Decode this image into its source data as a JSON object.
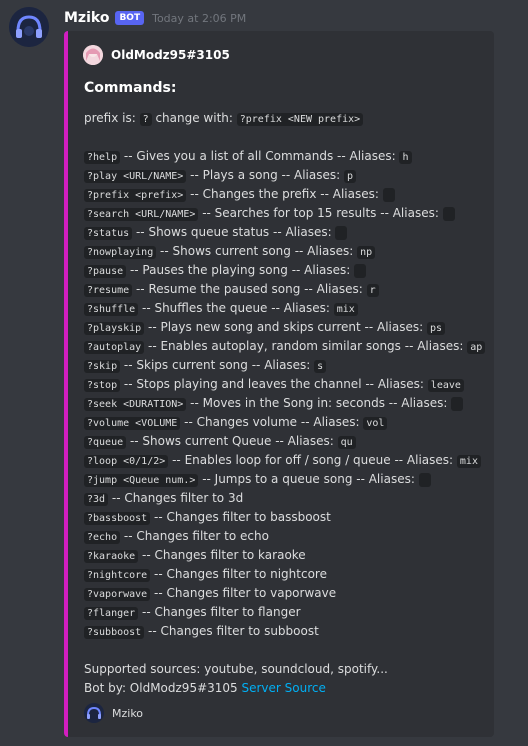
{
  "message": {
    "username": "Mziko",
    "bot_tag": "BOT",
    "timestamp": "Today at 2:06 PM"
  },
  "embed": {
    "accent_color": "#d21ec0",
    "author": "OldModz95#3105",
    "title": "Commands:",
    "prefix_line": {
      "text1": "prefix is: ",
      "code1": "?",
      "text2": " change with: ",
      "code2": "?prefix <NEW prefix>"
    },
    "commands": [
      {
        "cmd": "?help",
        "desc": " -- Gives you a list of all Commands -- Aliases: ",
        "alias": "h"
      },
      {
        "cmd": "?play <URL/NAME>",
        "desc": " -- Plays a song -- Aliases: ",
        "alias": "p"
      },
      {
        "cmd": "?prefix <prefix>",
        "desc": " -- Changes the prefix -- Aliases: ",
        "alias": ""
      },
      {
        "cmd": "?search <URL/NAME>",
        "desc": " -- Searches for top 15 results -- Aliases: ",
        "alias": ""
      },
      {
        "cmd": "?status",
        "desc": " -- Shows queue status -- Aliases: ",
        "alias": ""
      },
      {
        "cmd": "?nowplaying",
        "desc": " -- Shows current song -- Aliases: ",
        "alias": "np"
      },
      {
        "cmd": "?pause",
        "desc": " -- Pauses the playing song -- Aliases: ",
        "alias": ""
      },
      {
        "cmd": "?resume",
        "desc": " -- Resume the paused song -- Aliases: ",
        "alias": "r"
      },
      {
        "cmd": "?shuffle",
        "desc": " -- Shuffles the queue -- Aliases: ",
        "alias": "mix"
      },
      {
        "cmd": "?playskip",
        "desc": " -- Plays new song and skips current -- Aliases: ",
        "alias": "ps"
      },
      {
        "cmd": "?autoplay",
        "desc": " -- Enables autoplay, random similar songs -- Aliases: ",
        "alias": "ap"
      },
      {
        "cmd": "?skip",
        "desc": " -- Skips current song -- Aliases: ",
        "alias": "s"
      },
      {
        "cmd": "?stop",
        "desc": " -- Stops playing and leaves the channel -- Aliases: ",
        "alias": "leave"
      },
      {
        "cmd": "?seek <DURATION>",
        "desc": " -- Moves in the Song in: seconds -- Aliases: ",
        "alias": ""
      },
      {
        "cmd": "?volume <VOLUME",
        "desc": " -- Changes volume -- Aliases: ",
        "alias": "vol"
      },
      {
        "cmd": "?queue",
        "desc": " -- Shows current Queue -- Aliases: ",
        "alias": "qu"
      },
      {
        "cmd": "?loop <0/1/2>",
        "desc": " -- Enables loop for off / song / queue -- Aliases: ",
        "alias": "mix"
      },
      {
        "cmd": "?jump <Queue num.>",
        "desc": " -- Jumps to a queue song -- Aliases: ",
        "alias": ""
      },
      {
        "cmd": "?3d",
        "desc": " -- Changes filter to 3d"
      },
      {
        "cmd": "?bassboost",
        "desc": " -- Changes filter to bassboost"
      },
      {
        "cmd": "?echo",
        "desc": " -- Changes filter to echo"
      },
      {
        "cmd": "?karaoke",
        "desc": " -- Changes filter to karaoke"
      },
      {
        "cmd": "?nightcore",
        "desc": " -- Changes filter to nightcore"
      },
      {
        "cmd": "?vaporwave",
        "desc": " -- Changes filter to vaporwave"
      },
      {
        "cmd": "?flanger",
        "desc": " -- Changes filter to flanger"
      },
      {
        "cmd": "?subboost",
        "desc": " -- Changes filter to subboost"
      }
    ],
    "sources_line": "Supported sources: youtube, soundcloud, spotify...",
    "bot_by": "Bot by: OldModz95#3105 ",
    "server_source_link": "Server Source",
    "footer_text": "Mziko"
  },
  "icons": {
    "bot_avatar": "headphones-avatar-icon",
    "author_avatar": "anime-girl-avatar-icon",
    "footer_avatar": "headphones-avatar-icon"
  }
}
